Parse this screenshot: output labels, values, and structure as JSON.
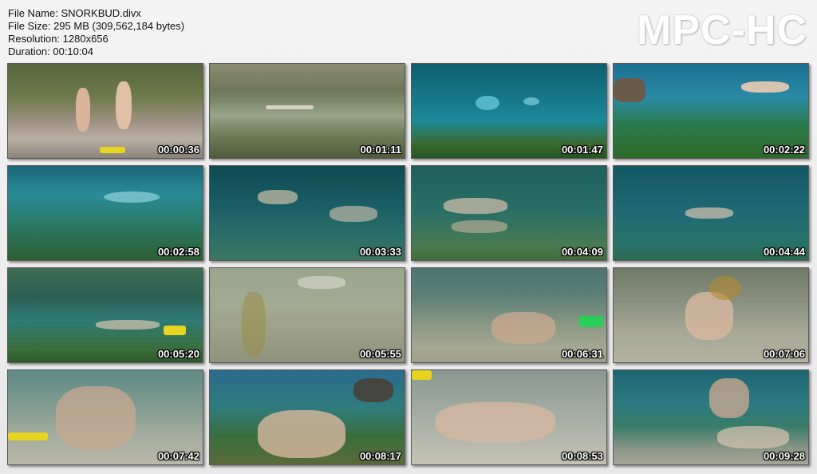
{
  "file_info": {
    "file_name": "File Name: SNORKBUD.divx",
    "file_size": "File Size: 295 MB (309,562,184 bytes)",
    "resolution": "Resolution: 1280x656",
    "duration": "Duration: 00:10:04"
  },
  "logo": "MPC-HC",
  "thumbnails": [
    {
      "time": "00:00:36",
      "scene": "dock"
    },
    {
      "time": "00:01:11",
      "scene": "spring"
    },
    {
      "time": "00:01:47",
      "scene": "blue"
    },
    {
      "time": "00:02:22",
      "scene": "blue2"
    },
    {
      "time": "00:02:58",
      "scene": "teal"
    },
    {
      "time": "00:03:33",
      "scene": "deep"
    },
    {
      "time": "00:04:09",
      "scene": "deep2"
    },
    {
      "time": "00:04:44",
      "scene": "deep3"
    },
    {
      "time": "00:05:20",
      "scene": "green"
    },
    {
      "time": "00:05:55",
      "scene": "murky"
    },
    {
      "time": "00:06:31",
      "scene": "sand"
    },
    {
      "time": "00:07:06",
      "scene": "sand2"
    },
    {
      "time": "00:07:42",
      "scene": "sand3"
    },
    {
      "time": "00:08:17",
      "scene": "blue3"
    },
    {
      "time": "00:08:53",
      "scene": "sand4"
    },
    {
      "time": "00:09:28",
      "scene": "teal2"
    }
  ]
}
